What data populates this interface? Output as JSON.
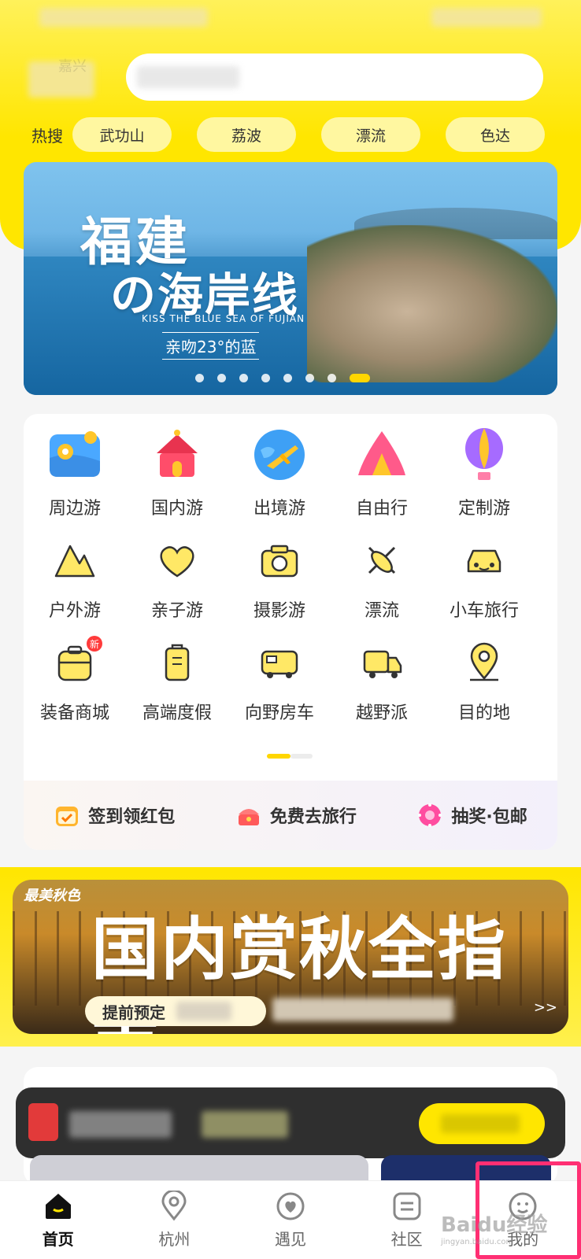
{
  "header": {
    "location_label": "嘉兴",
    "hot_search_label": "热搜",
    "hot_tags": [
      "武功山",
      "荔波",
      "漂流",
      "色达"
    ]
  },
  "banner": {
    "title_line1": "福建",
    "title_line2": "の海岸线",
    "subtitle_en": "KISS THE BLUE SEA OF FUJIAN",
    "subtitle_cn": "亲吻23°的蓝",
    "page_count": 8,
    "active_page": 8
  },
  "categories": [
    {
      "label": "周边游",
      "icon": "map-pin-icon"
    },
    {
      "label": "国内游",
      "icon": "palace-icon"
    },
    {
      "label": "出境游",
      "icon": "globe-plane-icon"
    },
    {
      "label": "自由行",
      "icon": "tent-icon"
    },
    {
      "label": "定制游",
      "icon": "hot-air-balloon-icon"
    },
    {
      "label": "户外游",
      "icon": "mountain-icon"
    },
    {
      "label": "亲子游",
      "icon": "heart-icon"
    },
    {
      "label": "摄影游",
      "icon": "camera-icon"
    },
    {
      "label": "漂流",
      "icon": "kayak-icon"
    },
    {
      "label": "小车旅行",
      "icon": "car-icon"
    },
    {
      "label": "装备商城",
      "icon": "backpack-icon",
      "badge": "新"
    },
    {
      "label": "高端度假",
      "icon": "suitcase-icon"
    },
    {
      "label": "向野房车",
      "icon": "rv-icon"
    },
    {
      "label": "越野派",
      "icon": "truck-icon"
    },
    {
      "label": "目的地",
      "icon": "location-pin-icon"
    }
  ],
  "promos": [
    {
      "label": "签到领红包",
      "icon": "calendar-check-icon"
    },
    {
      "label": "免费去旅行",
      "icon": "treasure-box-icon"
    },
    {
      "label": "抽奖·包邮",
      "icon": "lottery-wheel-icon"
    }
  ],
  "autumn_banner": {
    "tag": "最美秋色",
    "title": "国内赏秋全指南",
    "button_label": "提前预定",
    "more_label": ">>"
  },
  "tabbar": [
    {
      "label": "首页",
      "icon": "home-icon",
      "active": true
    },
    {
      "label": "杭州",
      "icon": "location-icon",
      "active": false
    },
    {
      "label": "遇见",
      "icon": "heart-circle-icon",
      "active": false
    },
    {
      "label": "社区",
      "icon": "community-icon",
      "active": false
    },
    {
      "label": "我的",
      "icon": "profile-icon",
      "active": false
    }
  ],
  "colors": {
    "brand_yellow": "#ffe600",
    "highlight_pink": "#ff2f73"
  },
  "watermark": {
    "text": "Baidu经验",
    "sub": "jingyan.baidu.com"
  }
}
